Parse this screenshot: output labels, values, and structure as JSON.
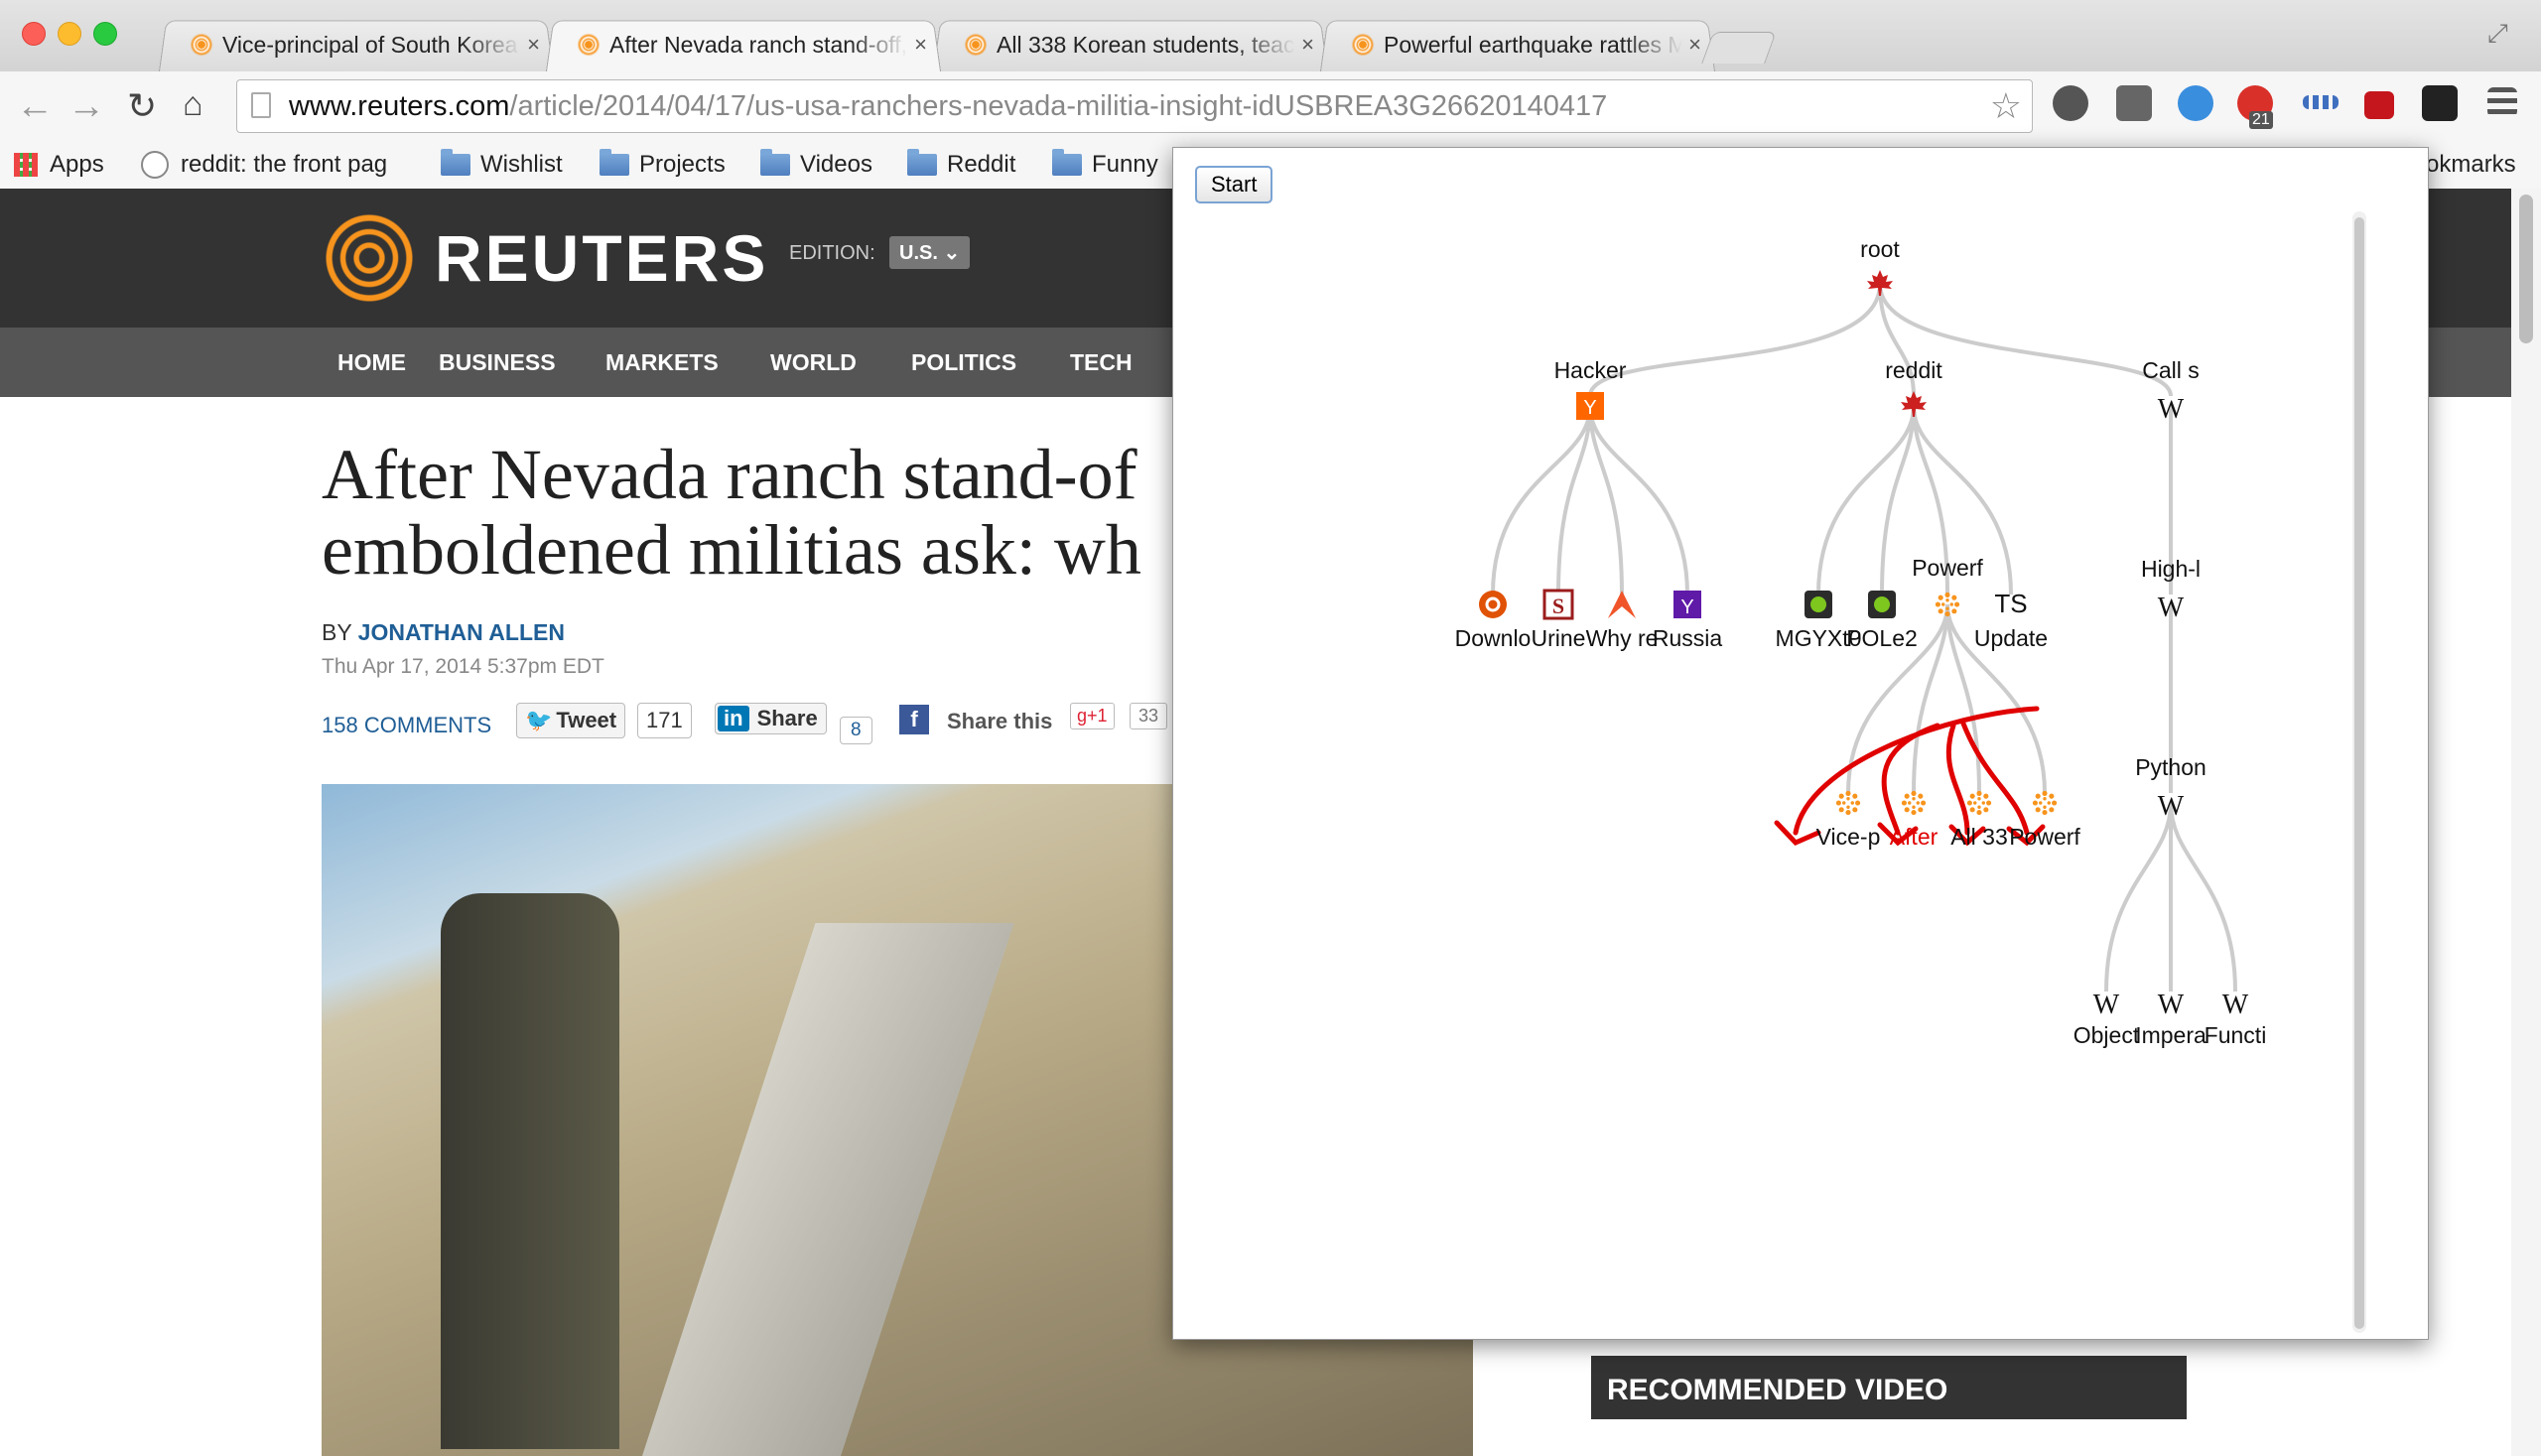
{
  "browser": {
    "tabs": [
      {
        "title": "Vice-principal of South Korea",
        "close": "×"
      },
      {
        "title": "After Nevada ranch stand-off,",
        "close": "×"
      },
      {
        "title": "All 338 Korean students, teache",
        "close": "×"
      },
      {
        "title": "Powerful earthquake rattles Mex",
        "close": "×"
      }
    ],
    "address_host": "www.reuters.com",
    "address_path": "/article/2014/04/17/us-usa-ranchers-nevada-militia-insight-idUSBREA3G26620140417",
    "abp_badge": "21",
    "bookmarks": [
      "Apps",
      "reddit: the front pag",
      "Wishlist",
      "Projects",
      "Videos",
      "Reddit",
      "Funny"
    ],
    "other_bookmarks": "okmarks"
  },
  "site": {
    "logo": "REUTERS",
    "edition_label": "EDITION:",
    "edition_value": "U.S.",
    "nav": [
      "HOME",
      "BUSINESS",
      "MARKETS",
      "WORLD",
      "POLITICS",
      "TECH"
    ],
    "headline": "After Nevada ranch stand-of\nemboldened militias ask: wh",
    "byline_prefix": "BY",
    "byline_author": "JONATHAN ALLEN",
    "dateline": "Thu Apr 17, 2014 5:37pm EDT",
    "comments": "158 COMMENTS",
    "tweet_label": "Tweet",
    "tweet_count": "171",
    "share_label": "Share",
    "share_count": "8",
    "share_this": "Share this",
    "gplus_label": "g+1",
    "gplus_count": "33",
    "recommended": "RECOMMENDED VIDEO"
  },
  "popup": {
    "start_label": "Start",
    "tree": {
      "root": "root",
      "level1": [
        "Hacker",
        "reddit",
        "Call s"
      ],
      "hacker_children": [
        "Downlo",
        "Urine",
        "Why re",
        "Russia"
      ],
      "reddit_children": [
        "MGYXt0",
        "POLe2",
        "Powerf",
        "Update"
      ],
      "reddit_child_icon_text": "TS",
      "powerf_children": [
        "Vice-p",
        "After",
        "All 33",
        "Powerf"
      ],
      "active_child": "After",
      "wiki_chain": [
        "High-l",
        "Python"
      ],
      "python_children": [
        "Object",
        "Impera",
        "Functi"
      ]
    },
    "colors": {
      "edge": "#cccccc",
      "active": "#e00000",
      "annotation": "#e00000",
      "reddit_red": "#cc1f1f",
      "hn_orange": "#ff6600"
    }
  }
}
